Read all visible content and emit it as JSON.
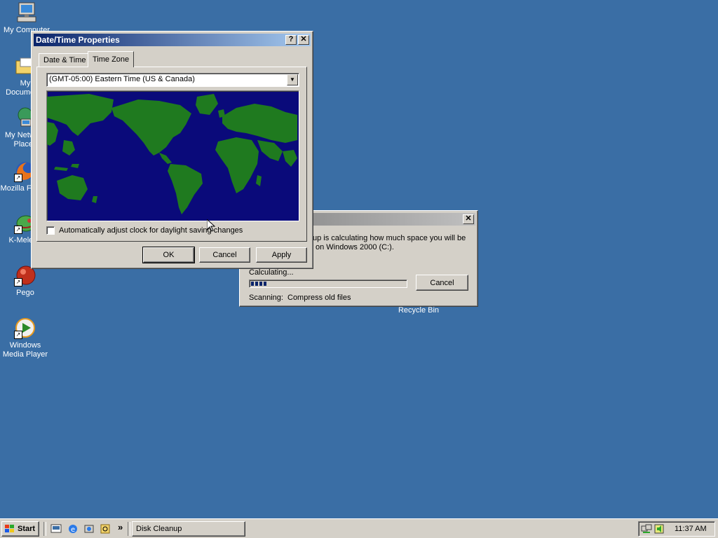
{
  "desktop": {
    "icons": [
      {
        "label": "My Computer",
        "icon": "computer-icon"
      },
      {
        "label": "My Documents",
        "icon": "folder-icon"
      },
      {
        "label": "My Network Places",
        "icon": "network-icon"
      },
      {
        "label": "Mozilla Firefox",
        "icon": "firefox-icon"
      },
      {
        "label": "K-Meleon",
        "icon": "kmeleon-icon"
      },
      {
        "label": "Pego",
        "icon": "pego-icon"
      },
      {
        "label": "Windows Media Player",
        "icon": "media-player-icon"
      },
      {
        "label": "Recycle Bin",
        "icon": "recycle-bin-icon"
      }
    ]
  },
  "datetime_dialog": {
    "title": "Date/Time Properties",
    "tabs": [
      "Date & Time",
      "Time Zone"
    ],
    "active_tab": "Time Zone",
    "timezone_selected": "(GMT-05:00) Eastern Time (US & Canada)",
    "dst_checkbox_label": "Automatically adjust clock for daylight saving changes",
    "dst_checked": false,
    "buttons": {
      "ok": "OK",
      "cancel": "Cancel",
      "apply": "Apply"
    }
  },
  "disk_cleanup_dialog": {
    "message_line1": "up is calculating how much space you will be",
    "message_line2": "on Windows 2000 (C:).",
    "calculating_label": "Calculating...",
    "progress_fraction": 0.1,
    "cancel_label": "Cancel",
    "scanning_label": "Scanning:",
    "scanning_item": "Compress old files"
  },
  "taskbar": {
    "start_label": "Start",
    "quick_launch_overflow": "»",
    "task_buttons": [
      "Disk Cleanup"
    ],
    "clock": "11:37 AM"
  },
  "colors": {
    "desktop": "#3a6ea5",
    "title_active": "#0a246a",
    "map_ocean": "#0a0a7a",
    "map_land": "#1f7a1f",
    "progress": "#0a246a"
  }
}
